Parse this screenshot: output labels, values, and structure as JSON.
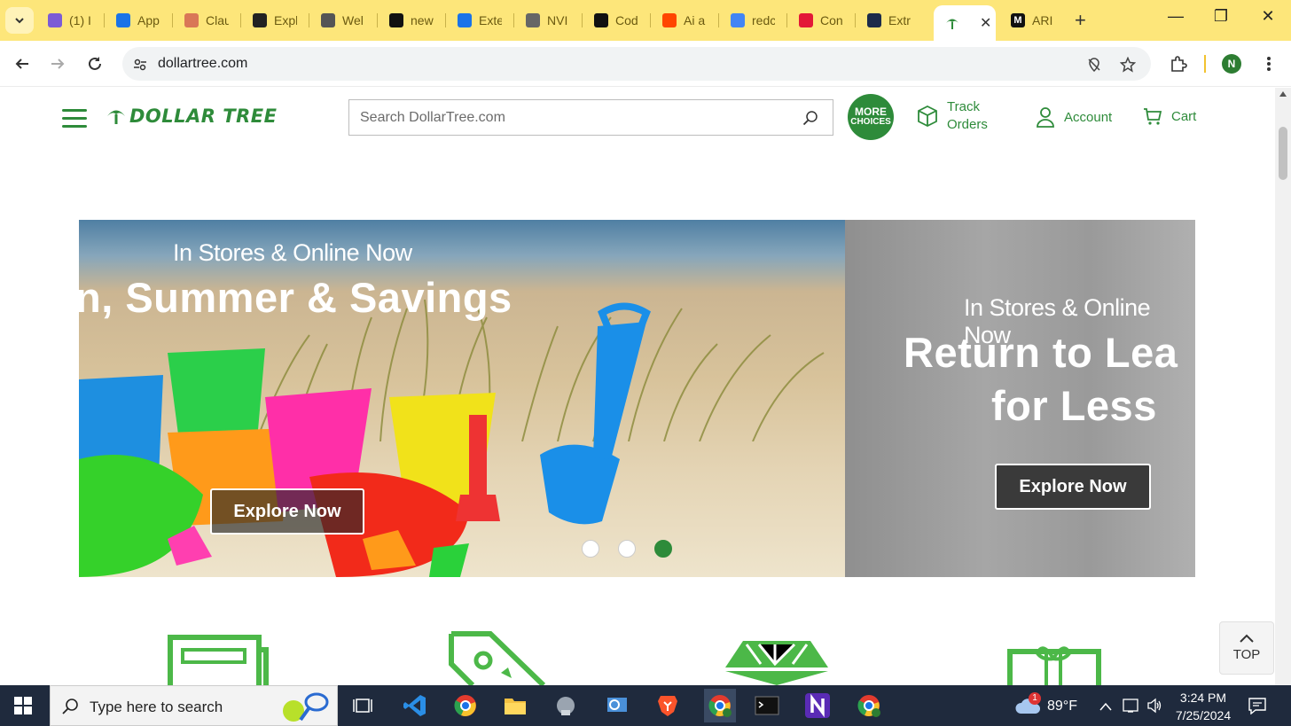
{
  "browser": {
    "tabs": [
      {
        "label": "(1) I",
        "color": "#7c5cd6"
      },
      {
        "label": "App",
        "color": "#1a73e8"
      },
      {
        "label": "Clau",
        "color": "#d97757"
      },
      {
        "label": "Expl",
        "color": "#222222"
      },
      {
        "label": "Wel",
        "color": "#555555"
      },
      {
        "label": "new",
        "color": "#111111"
      },
      {
        "label": "Exte",
        "color": "#1a73e8"
      },
      {
        "label": "NVI",
        "color": "#666666"
      },
      {
        "label": "Cod",
        "color": "#111111"
      },
      {
        "label": "Ai a",
        "color": "#ff4500"
      },
      {
        "label": "redc",
        "color": "#4285f4"
      },
      {
        "label": "Con",
        "color": "#e31837"
      },
      {
        "label": "Extr",
        "color": "#1c2b4a"
      }
    ],
    "active_tab": {
      "label": "",
      "close": "✕"
    },
    "last_tab": {
      "label": "ARI"
    },
    "new_tab": "+",
    "url": "dollartree.com",
    "profile_initial": "N"
  },
  "site": {
    "logo_text": "DOLLAR TREE",
    "search_placeholder": "Search DollarTree.com",
    "more_choices_line1": "MORE",
    "more_choices_line2": "CHOICES",
    "track_orders_line1": "Track",
    "track_orders_line2": "Orders",
    "account": "Account",
    "cart": "Cart",
    "hero": {
      "slide1_sub": "In Stores & Online Now",
      "slide1_title": "n, Summer & Savings",
      "slide1_cta": "Explore Now",
      "slide2_sub": "In Stores & Online Now",
      "slide2_title1": "Return to Lea",
      "slide2_title2": "for Less",
      "slide2_cta": "Explore Now",
      "active_dot": 3
    },
    "top_button": "TOP",
    "brand_color": "#2e8b3a"
  },
  "taskbar": {
    "search_placeholder": "Type here to search",
    "weather": "89°F",
    "weather_badge": "1",
    "time": "3:24 PM",
    "date": "7/25/2024"
  }
}
